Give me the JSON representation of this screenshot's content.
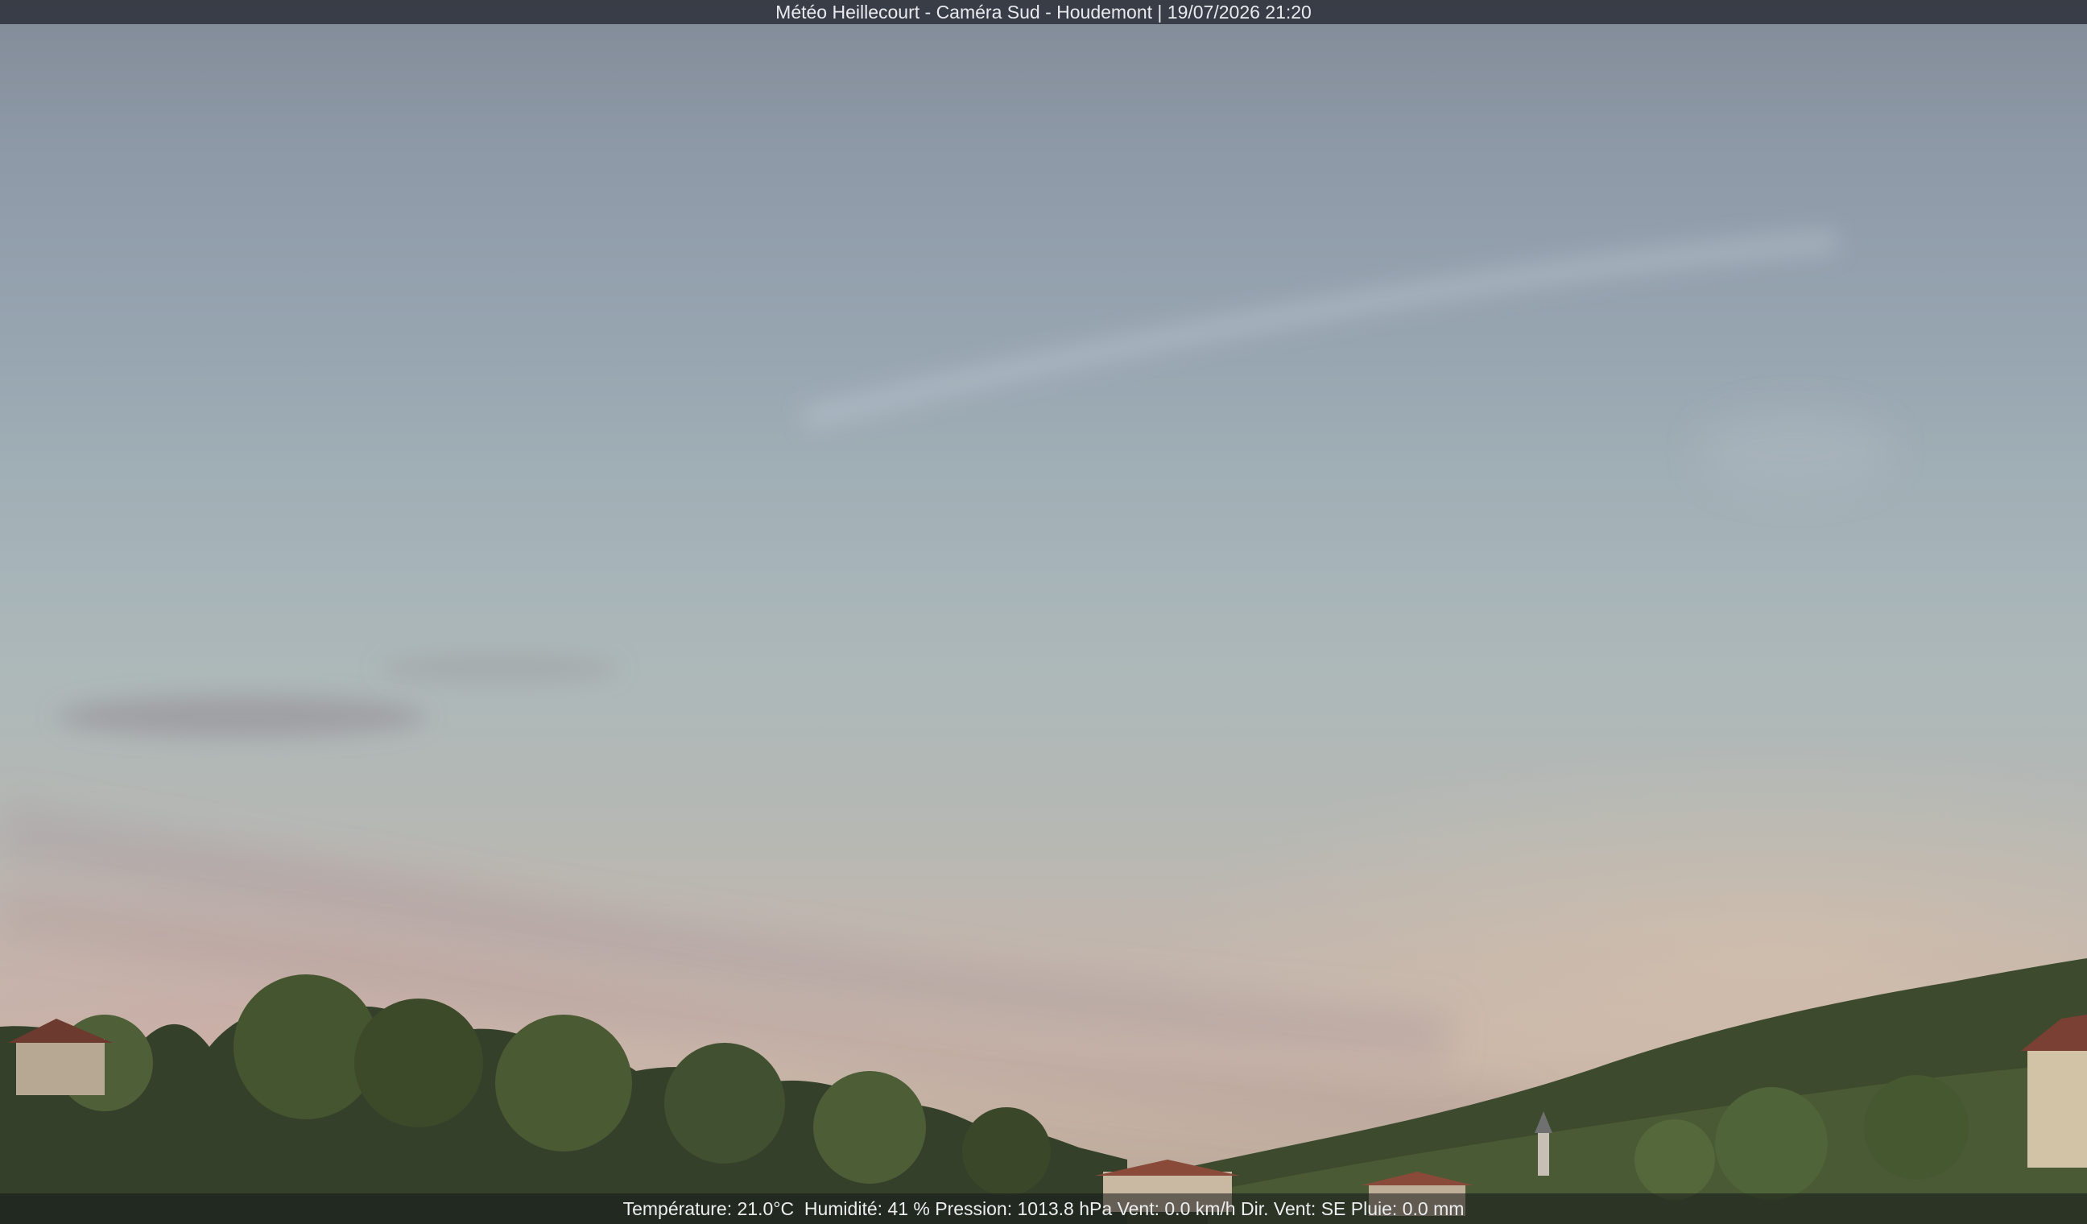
{
  "header": {
    "title": "Météo Heillecourt - Caméra Sud - Houdemont | 19/07/2026 21:20"
  },
  "weather": {
    "temperature": "Température: 21.0°C",
    "humidity": "Humidité: 41 %",
    "pressure": "Pression: 1013.8 hPa",
    "wind_speed": "Vent: 0.0 km/h",
    "wind_direction": "Dir. Vent: SE",
    "rain": "Pluie: 0.0 mm"
  },
  "colors": {
    "sky_top": "#828b98",
    "sky_horizon": "#c9b7aa",
    "foliage_dark": "#2f3a24",
    "foliage_light": "#5a6b3c",
    "roof_red": "#8a4a3a"
  }
}
